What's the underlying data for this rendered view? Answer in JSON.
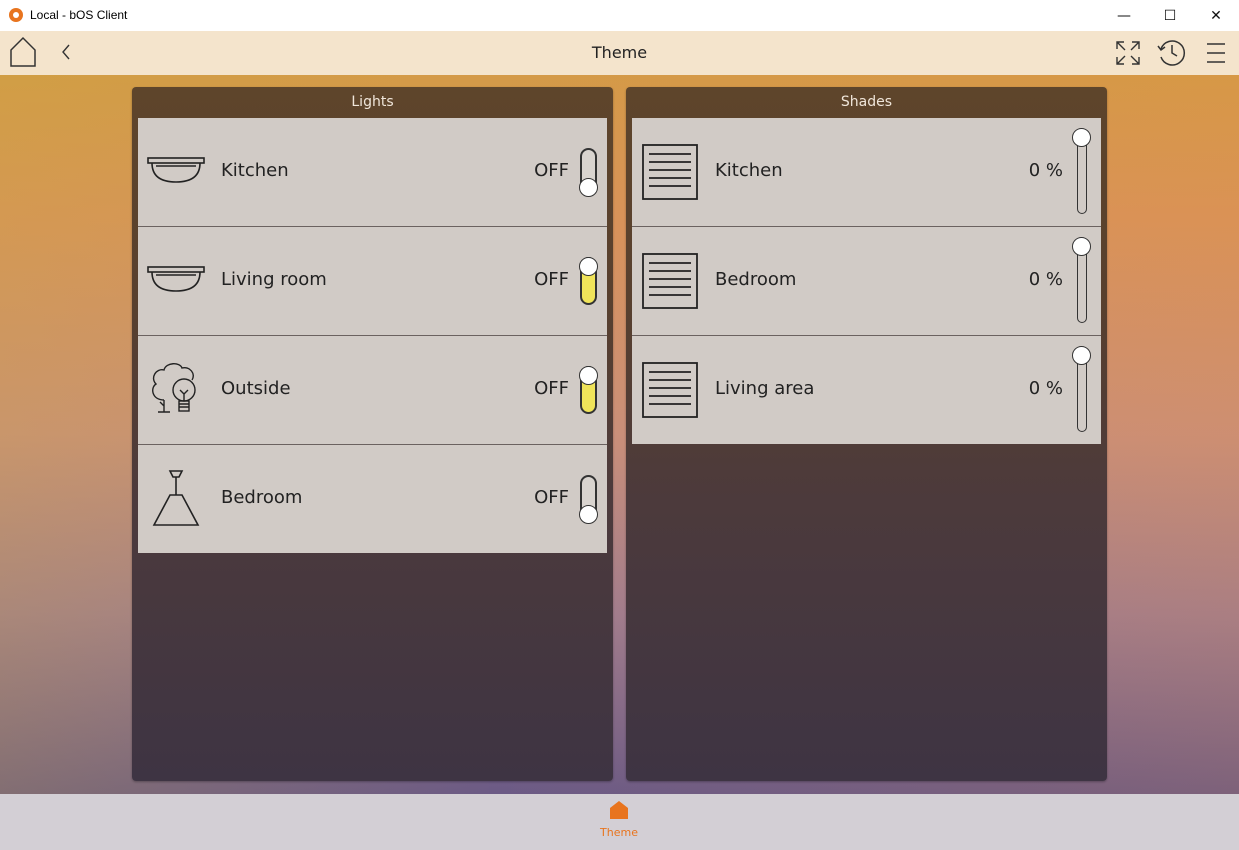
{
  "window": {
    "title": "Local - bOS Client",
    "minimize_glyph": "—",
    "maximize_glyph": "☐",
    "close_glyph": "✕"
  },
  "toolbar": {
    "title": "Theme",
    "icons": [
      "home-icon",
      "back-chevron-icon",
      "fullscreen-icon",
      "history-clock-icon",
      "menu-icon"
    ]
  },
  "lights": {
    "header": "Lights",
    "items": [
      {
        "label": "Kitchen",
        "state": "OFF",
        "icon": "ceiling-light-icon",
        "toggle_on": false
      },
      {
        "label": "Living room",
        "state": "OFF",
        "icon": "ceiling-light-icon",
        "toggle_on": true
      },
      {
        "label": "Outside",
        "state": "OFF",
        "icon": "tree-bulb-icon",
        "toggle_on": true
      },
      {
        "label": "Bedroom",
        "state": "OFF",
        "icon": "pendant-lamp-icon",
        "toggle_on": false
      }
    ]
  },
  "shades": {
    "header": "Shades",
    "items": [
      {
        "label": "Kitchen",
        "value": "0 %",
        "icon": "shade-icon",
        "position_pct": 0
      },
      {
        "label": "Bedroom",
        "value": "0 %",
        "icon": "shade-icon",
        "position_pct": 0
      },
      {
        "label": "Living area",
        "value": "0 %",
        "icon": "shade-icon",
        "position_pct": 0
      }
    ]
  },
  "bottom_nav": {
    "tab_label": "Theme",
    "icon": "home-filled-icon"
  },
  "colors": {
    "accent": "#e8741e",
    "toggle_on": "#f0e45a",
    "tile_bg": "#d1cbc6"
  }
}
